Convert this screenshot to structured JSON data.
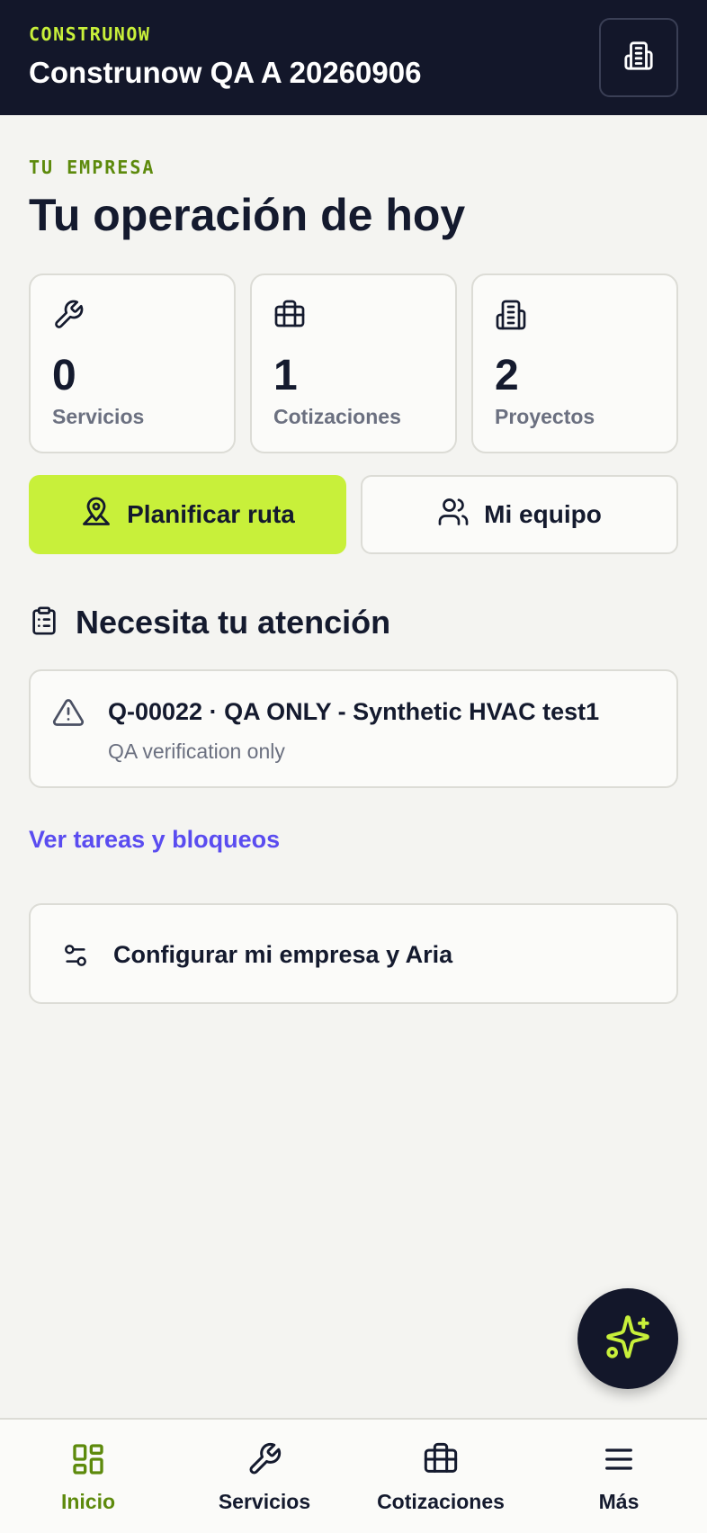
{
  "header": {
    "brand": "CONSTRUNOW",
    "company_name": "Construnow QA A 20260906",
    "company_button_icon": "building-icon"
  },
  "main": {
    "eyebrow": "TU EMPRESA",
    "title": "Tu operación de hoy",
    "stats": [
      {
        "icon": "wrench-icon",
        "value": "0",
        "label": "Servicios"
      },
      {
        "icon": "briefcase-icon",
        "value": "1",
        "label": "Cotizaciones"
      },
      {
        "icon": "building-icon",
        "value": "2",
        "label": "Proyectos"
      }
    ],
    "actions": {
      "route_label": "Planificar ruta",
      "team_label": "Mi equipo"
    },
    "attention": {
      "title": "Necesita tu atención",
      "items": [
        {
          "title": "Q-00022 · QA ONLY - Synthetic HVAC test1",
          "subtitle": "QA verification only"
        }
      ]
    },
    "tasks_link": "Ver tareas y bloqueos",
    "config_label": "Configurar mi empresa y Aria"
  },
  "bottom_nav": [
    {
      "label": "Inicio",
      "icon": "grid-icon",
      "active": true
    },
    {
      "label": "Servicios",
      "icon": "wrench-icon",
      "active": false
    },
    {
      "label": "Cotizaciones",
      "icon": "briefcase-icon",
      "active": false
    },
    {
      "label": "Más",
      "icon": "menu-icon",
      "active": false
    }
  ],
  "colors": {
    "accent": "#c8f03a",
    "dark": "#13172a",
    "link": "#5a4cf0",
    "eyebrow": "#5d8a0c",
    "background": "#f4f4f1"
  }
}
